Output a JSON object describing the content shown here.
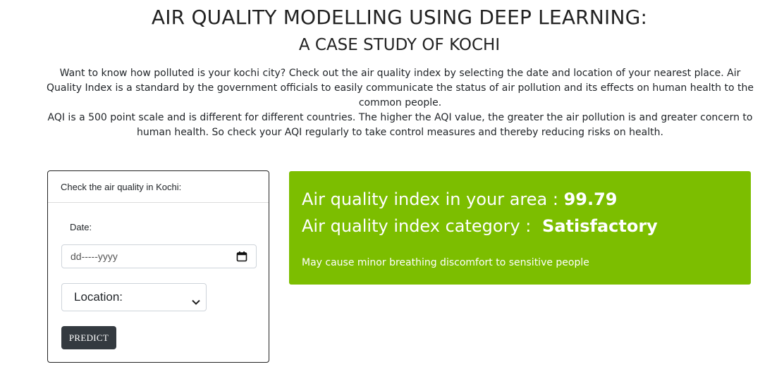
{
  "header": {
    "title": "AIR QUALITY MODELLING USING DEEP LEARNING:",
    "subtitle": "A CASE STUDY OF KOCHI"
  },
  "intro": {
    "paragraph1": "Want to know how polluted is your kochi city? Check out the air quality index by selecting the date and location of your nearest place. Air Quality Index is a standard by the government officials to easily communicate the status of air pollution and its effects on human health to the common people.",
    "paragraph2": "AQI is a 500 point scale and is different for different countries. The higher the AQI value, the greater the air pollution is and greater concern to human health. So check your AQI regularly to take control measures and thereby reducing risks on health."
  },
  "form": {
    "header": "Check the air quality in Kochi:",
    "date_label": "Date:",
    "date_placeholder": "dd-----yyyy",
    "location_selected": "Location:",
    "predict_label": "PREDICT"
  },
  "result": {
    "index_label": "Air quality index in your area :",
    "index_value": "99.79",
    "category_label": "Air quality index category :",
    "category_value": "Satisfactory",
    "note": "May cause minor breathing discomfort to sensitive people",
    "panel_color": "#7cbe00"
  },
  "icons": {
    "date_picker": "calendar-icon",
    "select_arrow": "chevron-down-icon"
  }
}
